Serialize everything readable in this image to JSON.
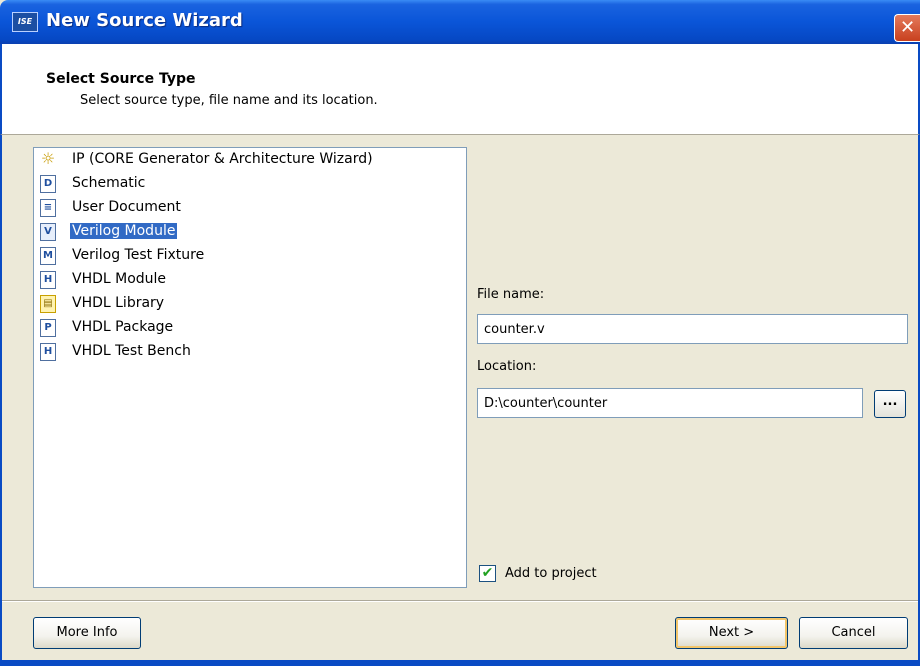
{
  "window": {
    "title": "New Source Wizard",
    "app_icon_label": "ISE",
    "close_glyph": "✕"
  },
  "header": {
    "title": "Select Source Type",
    "subtitle": "Select source type, file name and its location."
  },
  "source_types": [
    {
      "label": "IP (CORE Generator & Architecture Wizard)",
      "icon": "ip-core-bulb-icon",
      "glyph": "☼",
      "selected": false
    },
    {
      "label": "Schematic",
      "icon": "schematic-icon",
      "glyph": "D",
      "selected": false
    },
    {
      "label": "User Document",
      "icon": "user-document-icon",
      "glyph": "≡",
      "selected": false
    },
    {
      "label": "Verilog Module",
      "icon": "verilog-module-icon",
      "glyph": "V",
      "selected": true
    },
    {
      "label": "Verilog Test Fixture",
      "icon": "verilog-test-fixture-icon",
      "glyph": "M",
      "selected": false
    },
    {
      "label": "VHDL Module",
      "icon": "vhdl-module-icon",
      "glyph": "H",
      "selected": false
    },
    {
      "label": "VHDL Library",
      "icon": "vhdl-library-icon",
      "glyph": "▤",
      "selected": false
    },
    {
      "label": "VHDL Package",
      "icon": "vhdl-package-icon",
      "glyph": "P",
      "selected": false
    },
    {
      "label": "VHDL Test Bench",
      "icon": "vhdl-test-bench-icon",
      "glyph": "H",
      "selected": false
    }
  ],
  "form": {
    "file_name_label": "File name:",
    "file_name_value": "counter.v",
    "location_label": "Location:",
    "location_value": "D:\\counter\\counter",
    "browse_label": "...",
    "add_to_project_label": "Add to project",
    "add_to_project_checked": true,
    "check_glyph": "✔"
  },
  "buttons": {
    "more_info": "More Info",
    "next": "Next >",
    "cancel": "Cancel"
  },
  "colors": {
    "title_bar": "#0a55d8",
    "selection": "#316ac5",
    "dialog_bg": "#ece9d8"
  }
}
